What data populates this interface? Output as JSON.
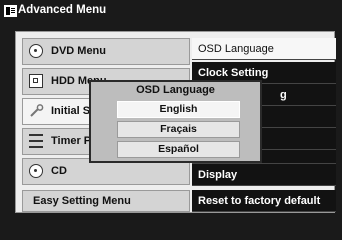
{
  "window": {
    "title": "Advanced Menu",
    "icon": "menu-book-icon"
  },
  "left_menu": [
    {
      "label": "DVD Menu",
      "icon": "disc-icon"
    },
    {
      "label": "HDD Menu",
      "icon": "hdd-icon"
    },
    {
      "label": "Initial Setup",
      "icon": "wrench-icon"
    },
    {
      "label": "Timer Prog",
      "icon": "timer-list-icon"
    },
    {
      "label": "CD",
      "icon": "cd-icon"
    }
  ],
  "easy_menu": {
    "label": "Easy Setting Menu"
  },
  "right_menu": [
    {
      "label": "OSD Language"
    },
    {
      "label": "Clock Setting"
    },
    {
      "label": "g"
    },
    {
      "label": ""
    },
    {
      "label": ""
    },
    {
      "label": "Display"
    },
    {
      "label": "Reset to factory default"
    }
  ],
  "popup": {
    "title": "OSD Language",
    "options": [
      "English",
      "Fraçais",
      "Español"
    ]
  },
  "colors": {
    "background": "#1a1a1a",
    "panel": "#eeeeee",
    "popup": "#bdbdbd"
  }
}
